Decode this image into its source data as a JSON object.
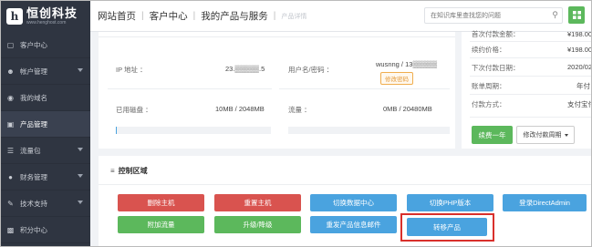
{
  "sidebar": {
    "logo_name": "恒创科技",
    "logo_url": "www.henghost.com",
    "items": [
      {
        "label": "客户中心",
        "icon": "monitor",
        "caret": false,
        "active": false
      },
      {
        "label": "帐户管理",
        "icon": "user",
        "caret": true,
        "active": false
      },
      {
        "label": "我的域名",
        "icon": "globe",
        "caret": false,
        "active": false
      },
      {
        "label": "产品管理",
        "icon": "box",
        "caret": false,
        "active": true
      },
      {
        "label": "流量包",
        "icon": "layers",
        "caret": true,
        "active": false
      },
      {
        "label": "财务管理",
        "icon": "coin",
        "caret": true,
        "active": false
      },
      {
        "label": "技术支持",
        "icon": "wrench",
        "caret": true,
        "active": false
      },
      {
        "label": "积分中心",
        "icon": "gift",
        "caret": false,
        "active": false
      }
    ]
  },
  "header": {
    "crumbs": [
      "网站首页",
      "客户中心",
      "我的产品与服务"
    ],
    "crumb_current": "产品详情",
    "search_placeholder": "在知识库里查找您的问题"
  },
  "info": {
    "ip_label": "IP 地址 ：",
    "ip_value": "23.▒▒▒▒▒.5",
    "user_label": "用户名/密码 ：",
    "user_value": "wusnng / 13▒▒▒▒▒",
    "change_pwd": "修改密码",
    "disk_label": "已用磁盘 ：",
    "disk_value": "10MB / 2048MB",
    "traffic_label": "流量 ：",
    "traffic_value": "0MB / 20480MB",
    "disk_used_fraction": 0.005,
    "traffic_used_fraction": 0.0
  },
  "billing": {
    "rows": [
      {
        "label": "首次付款金额：",
        "value": "¥198.00元"
      },
      {
        "label": "续约价格：",
        "value": "¥198.00元"
      },
      {
        "label": "下次付款日期：",
        "value": "2020/02/05"
      },
      {
        "label": "账单周期：",
        "value": "年付"
      },
      {
        "label": "付款方式：",
        "value": "支付宝付款"
      }
    ],
    "renew_label": "续费一年",
    "cycle_label": "修改付款周期"
  },
  "control": {
    "title": "控制区域",
    "row1": [
      {
        "label": "删除主机",
        "color": "#d9534f"
      },
      {
        "label": "重置主机",
        "color": "#d9534f"
      },
      {
        "label": "切换数据中心",
        "color": "#4aa3df"
      },
      {
        "label": "切换PHP版本",
        "color": "#4aa3df"
      },
      {
        "label": "登录DirectAdmin",
        "color": "#4aa3df"
      }
    ],
    "row2": [
      {
        "label": "附加流量",
        "color": "#5cb85c"
      },
      {
        "label": "升级/降级",
        "color": "#5cb85c"
      },
      {
        "label": "重发产品信息邮件",
        "color": "#4aa3df"
      },
      {
        "label": "转移产品",
        "color": "#4aa3df"
      }
    ]
  }
}
